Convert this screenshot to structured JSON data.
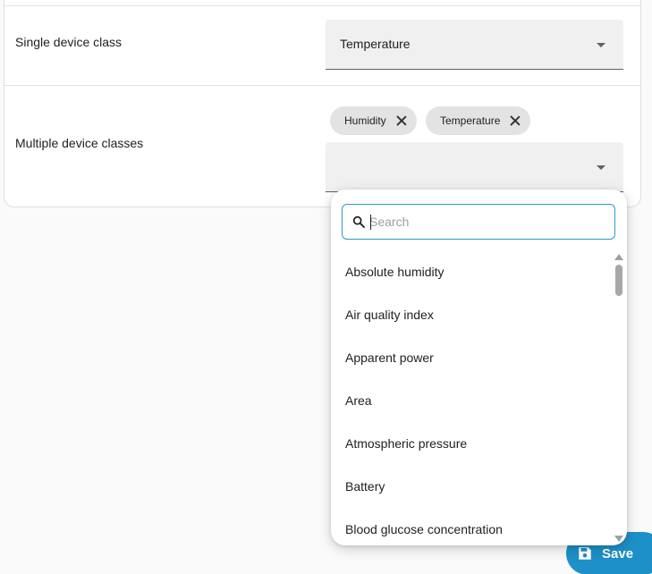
{
  "rows": {
    "single": {
      "label": "Single device class",
      "value": "Temperature"
    },
    "multiple": {
      "label": "Multiple device classes",
      "chips": [
        "Humidity",
        "Temperature"
      ]
    }
  },
  "dropdown": {
    "search_placeholder": "Search",
    "options": [
      "Absolute humidity",
      "Air quality index",
      "Apparent power",
      "Area",
      "Atmospheric pressure",
      "Battery",
      "Blood glucose concentration"
    ]
  },
  "fab": {
    "label": "Save"
  },
  "colors": {
    "accent": "#2b9bc8",
    "fab": "#1e90c8"
  }
}
